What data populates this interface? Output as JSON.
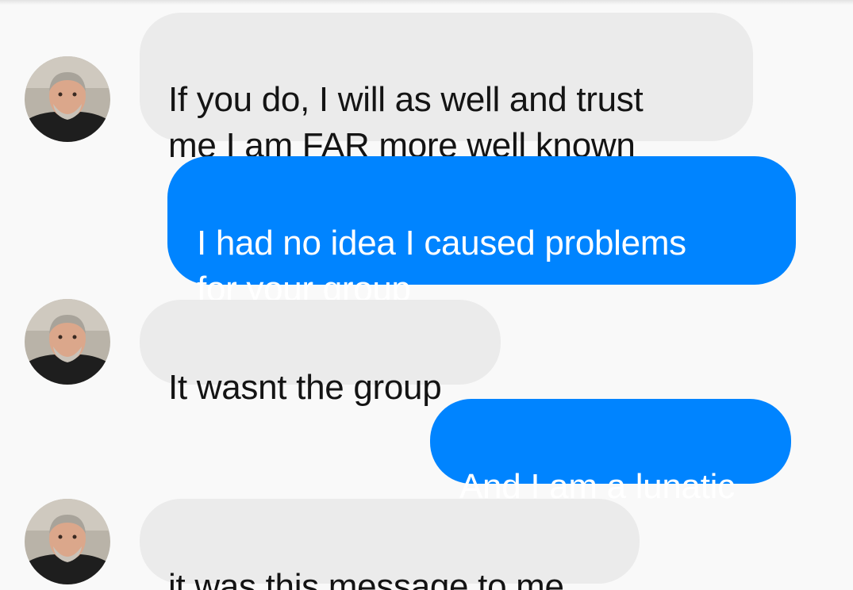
{
  "conversation": {
    "messages": [
      {
        "direction": "incoming",
        "text": "If you do, I will as well and trust\nme I am FAR more well known"
      },
      {
        "direction": "outgoing",
        "text": "I had no idea I caused problems\nfor your group"
      },
      {
        "direction": "incoming",
        "text": "It wasnt the group"
      },
      {
        "direction": "outgoing",
        "text": "And I am a lunatic"
      },
      {
        "direction": "incoming",
        "text": "it was this message to me"
      }
    ]
  },
  "colors": {
    "background": "#f9f9f9",
    "incoming_bubble": "#ebebeb",
    "incoming_text": "#141414",
    "outgoing_bubble": "#0084ff",
    "outgoing_text": "#ffffff"
  },
  "icons": {
    "avatar": "contact-photo-avatar"
  }
}
